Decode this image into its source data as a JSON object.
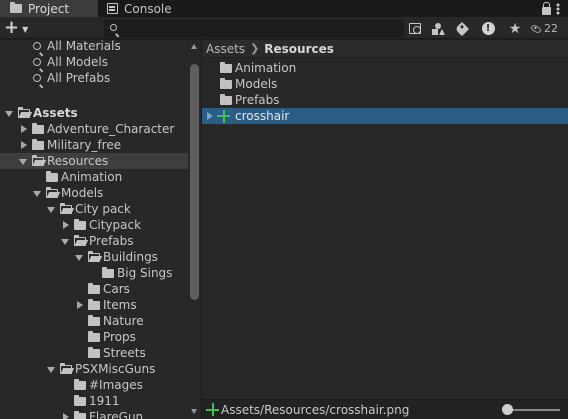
{
  "tabs": [
    {
      "label": "Project",
      "icon": "folder-icon",
      "active": true
    },
    {
      "label": "Console",
      "icon": "console-icon",
      "active": false
    }
  ],
  "toolbar": {
    "create_label": "+",
    "search": {
      "value": "",
      "placeholder": ""
    },
    "hidden_count": "22"
  },
  "tree": {
    "favorites": [
      {
        "label": "All Materials"
      },
      {
        "label": "All Models"
      },
      {
        "label": "All Prefabs"
      }
    ],
    "items": [
      {
        "label": "Assets",
        "depth": 0,
        "expanded": true,
        "bold": true
      },
      {
        "label": "Adventure_Character",
        "depth": 1,
        "expanded": false
      },
      {
        "label": "Military_free",
        "depth": 1,
        "expanded": false
      },
      {
        "label": "Resources",
        "depth": 1,
        "expanded": true,
        "selected": true
      },
      {
        "label": "Animation",
        "depth": 2,
        "leaf": true
      },
      {
        "label": "Models",
        "depth": 2,
        "expanded": true
      },
      {
        "label": "City pack",
        "depth": 3,
        "expanded": true
      },
      {
        "label": "Citypack",
        "depth": 4,
        "expanded": false
      },
      {
        "label": "Prefabs",
        "depth": 4,
        "expanded": true
      },
      {
        "label": "Buildings",
        "depth": 5,
        "expanded": true
      },
      {
        "label": "Big Sings",
        "depth": 6,
        "leaf": true
      },
      {
        "label": "Cars",
        "depth": 5,
        "leaf": true
      },
      {
        "label": "Items",
        "depth": 5,
        "expanded": false
      },
      {
        "label": "Nature",
        "depth": 5,
        "leaf": true
      },
      {
        "label": "Props",
        "depth": 5,
        "leaf": true
      },
      {
        "label": "Streets",
        "depth": 5,
        "leaf": true
      },
      {
        "label": "PSXMiscGuns",
        "depth": 3,
        "expanded": true
      },
      {
        "label": "#Images",
        "depth": 4,
        "leaf": true
      },
      {
        "label": "1911",
        "depth": 4,
        "leaf": true
      },
      {
        "label": "FlareGun",
        "depth": 4,
        "expanded": false
      }
    ]
  },
  "breadcrumb": {
    "root": "Assets",
    "current": "Resources"
  },
  "assets": [
    {
      "label": "Animation",
      "type": "folder"
    },
    {
      "label": "Models",
      "type": "folder"
    },
    {
      "label": "Prefabs",
      "type": "folder"
    },
    {
      "label": "crosshair",
      "type": "sprite",
      "selected": true
    }
  ],
  "status": {
    "path": "Assets/Resources/crosshair.png"
  },
  "colors": {
    "selection": "#2c5d87",
    "sprite_icon": "#3fbf5a"
  }
}
